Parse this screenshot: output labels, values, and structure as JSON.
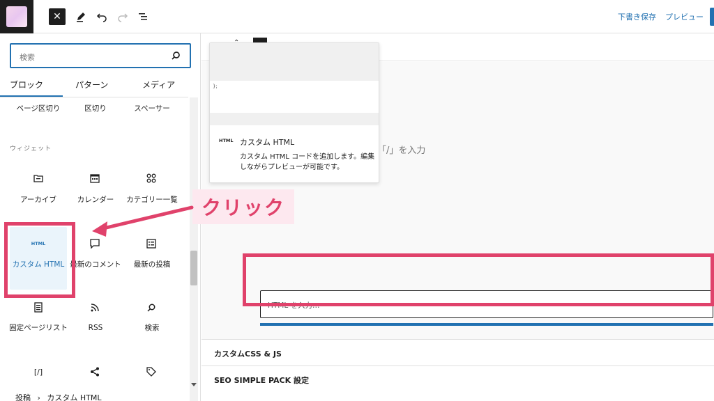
{
  "toolbar": {
    "draft_label": "下書き保存",
    "preview_label": "プレビュー"
  },
  "inserter": {
    "search_placeholder": "検索",
    "tabs": [
      "ブロック",
      "パターン",
      "メディア"
    ],
    "design_row": [
      "ページ区切り",
      "区切り",
      "スペーサー"
    ],
    "widgets_category": "ウィジェット",
    "widgets_row1": [
      "アーカイブ",
      "カレンダー",
      "カテゴリー一覧"
    ],
    "widgets_row2": [
      "カスタム HTML",
      "最新のコメント",
      "最新の投稿"
    ],
    "widgets_row3": [
      "固定ページリスト",
      "RSS",
      "検索"
    ],
    "html_icon_text": "HTML"
  },
  "annotation": {
    "click_label": "クリック"
  },
  "editor": {
    "slash_hint": "「/」を入力",
    "html_placeholder": "HTML を入力…",
    "meta_boxes": [
      "カスタムCSS & JS",
      "SEO SIMPLE PACK 設定"
    ]
  },
  "preview": {
    "code_text": "};",
    "icon_text": "HTML",
    "title": "カスタム HTML",
    "description": "カスタム HTML コードを追加します。編集しながらプレビューが可能です。"
  },
  "breadcrumb": {
    "root": "投稿",
    "separator": "›",
    "current": "カスタム HTML"
  },
  "colors": {
    "accent": "#2271b1",
    "highlight": "#e0426b",
    "highlight_bg": "#fde8ef"
  }
}
